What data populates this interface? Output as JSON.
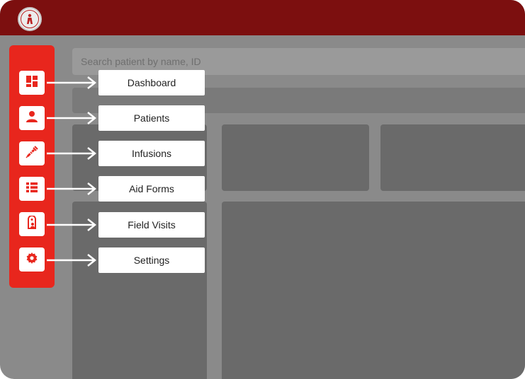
{
  "header": {
    "logo": "organization-logo"
  },
  "search": {
    "placeholder": "Search patient by name, ID"
  },
  "sidebar": {
    "items": [
      {
        "label": "Dashboard",
        "icon": "dashboard-icon"
      },
      {
        "label": "Patients",
        "icon": "person-icon"
      },
      {
        "label": "Infusions",
        "icon": "syringe-icon"
      },
      {
        "label": "Aid Forms",
        "icon": "list-icon"
      },
      {
        "label": "Field Visits",
        "icon": "visit-tag-icon"
      },
      {
        "label": "Settings",
        "icon": "gear-icon"
      }
    ]
  },
  "colors": {
    "brand_red": "#e8261d",
    "topbar": "#7c0f0f",
    "overlay": "#8a8a8a"
  }
}
